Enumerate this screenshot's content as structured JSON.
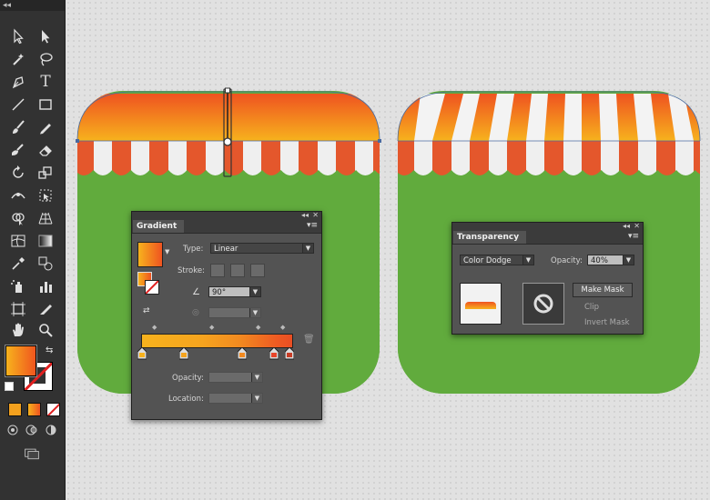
{
  "toolbar": {
    "collapse_glyph": "◂◂",
    "type_tool_label": "T",
    "tools": [
      "selection-tool",
      "direct-selection-tool",
      "magic-wand-tool",
      "lasso-tool",
      "pen-tool",
      "type-tool",
      "line-tool",
      "rectangle-tool",
      "paintbrush-tool",
      "pencil-tool",
      "blob-brush-tool",
      "eraser-tool",
      "rotate-tool",
      "scale-tool",
      "width-tool",
      "free-transform-tool",
      "shape-builder-tool",
      "perspective-grid-tool",
      "mesh-tool",
      "gradient-tool",
      "eyedropper-tool",
      "blend-tool",
      "symbol-sprayer-tool",
      "column-graph-tool",
      "artboard-tool",
      "slice-tool",
      "hand-tool",
      "zoom-tool"
    ]
  },
  "gradient_panel": {
    "collapse_glyph": "◂◂",
    "close_glyph": "✕",
    "tab_label": "Gradient",
    "menu_glyph": "▾≡",
    "type_label": "Type:",
    "type_value": "Linear",
    "stroke_label": "Stroke:",
    "angle_value": "90°",
    "opacity_label": "Opacity:",
    "location_label": "Location:",
    "gradient_start_color": "#f7b21d",
    "gradient_end_color": "#ef5320"
  },
  "transparency_panel": {
    "collapse_glyph": "◂◂",
    "close_glyph": "✕",
    "tab_label": "Transparency",
    "menu_glyph": "▾≡",
    "blend_mode": "Color Dodge",
    "opacity_label": "Opacity:",
    "opacity_value": "40%",
    "make_mask_label": "Make Mask",
    "clip_label": "Clip",
    "invert_mask_label": "Invert Mask"
  },
  "colors": {
    "icon_green": "#61ab3d",
    "awning_orange": "#f1a21f",
    "stripe_red": "#e4572c",
    "stripe_white": "#efefef",
    "panel_bg": "#535353"
  }
}
